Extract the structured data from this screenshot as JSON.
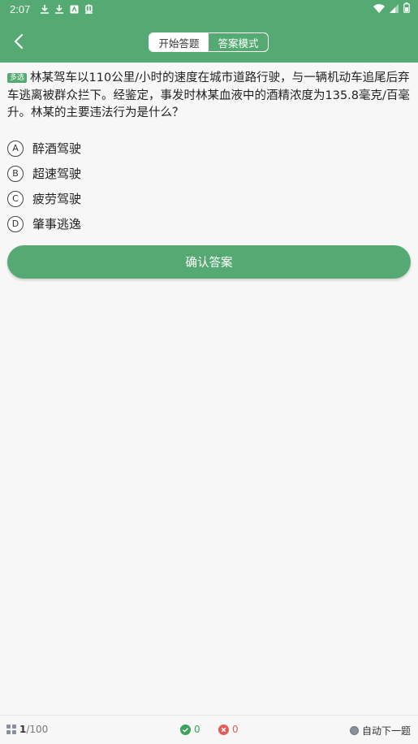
{
  "status_bar": {
    "time": "2:07",
    "left_icons": [
      "download-icon",
      "download-icon",
      "app-icon",
      "bug-icon"
    ],
    "right_icons": [
      "wifi-icon",
      "signal-icon",
      "battery-icon"
    ]
  },
  "header": {
    "tabs": [
      {
        "label": "开始答题",
        "active": true
      },
      {
        "label": "答案模式",
        "active": false
      }
    ]
  },
  "question": {
    "type_badge": "多选",
    "text": "林某驾车以110公里/小时的速度在城市道路行驶，与一辆机动车追尾后弃车逃离被群众拦下。经鉴定，事发时林某血液中的酒精浓度为135.8毫克/百毫升。林某的主要违法行为是什么？"
  },
  "options": [
    {
      "letter": "A",
      "text": "醉酒驾驶"
    },
    {
      "letter": "B",
      "text": "超速驾驶"
    },
    {
      "letter": "C",
      "text": "疲劳驾驶"
    },
    {
      "letter": "D",
      "text": "肇事逃逸"
    }
  ],
  "confirm_label": "确认答案",
  "bottom_bar": {
    "current": "1",
    "total": "/100",
    "correct_count": "0",
    "wrong_count": "0",
    "auto_next_label": "自动下一题"
  },
  "colors": {
    "brand": "#54aa72",
    "correct": "#3aa35c",
    "wrong": "#e55a5a"
  }
}
